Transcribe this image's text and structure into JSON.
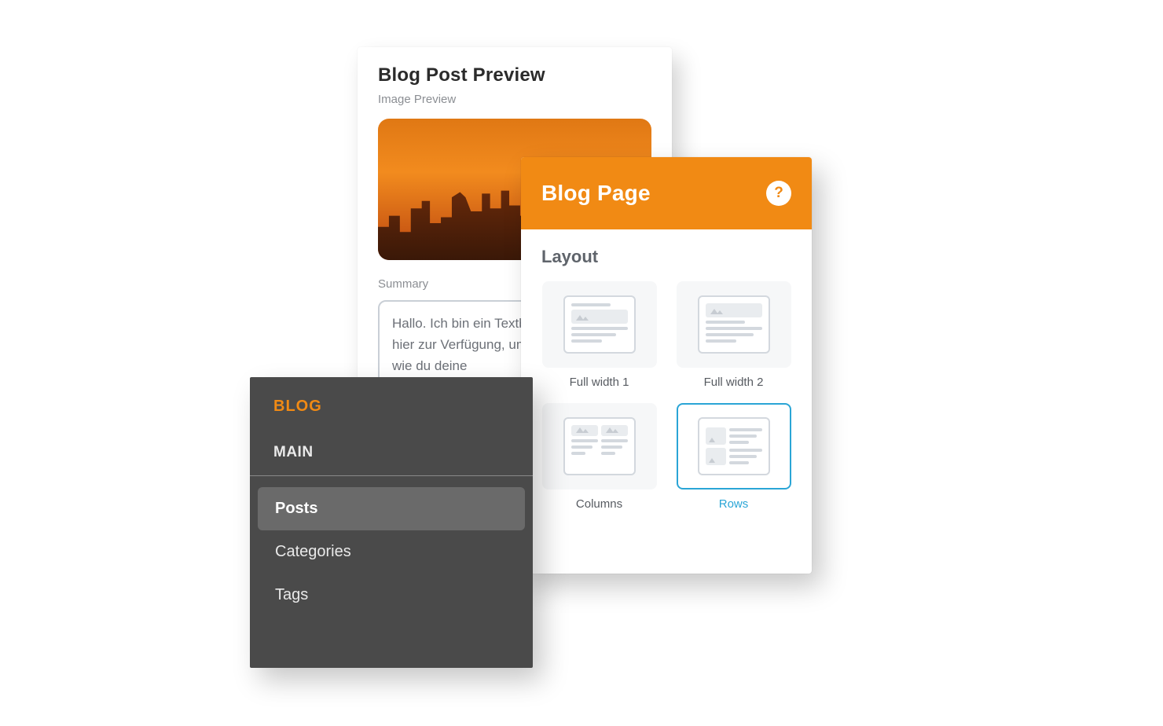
{
  "preview": {
    "title": "Blog Post Preview",
    "image_label": "Image Preview",
    "summary_label": "Summary",
    "summary_text": "Hallo. Ich bin ein Textbaustein, der dir hier zur Verfügung, um dir zu erklären, wie du deine"
  },
  "blog_page": {
    "header_title": "Blog Page",
    "help_symbol": "?",
    "section_title": "Layout",
    "layouts": [
      {
        "label": "Full width 1",
        "type": "full1",
        "selected": false
      },
      {
        "label": "Full width 2",
        "type": "full2",
        "selected": false
      },
      {
        "label": "Columns",
        "type": "columns",
        "selected": false
      },
      {
        "label": "Rows",
        "type": "rows",
        "selected": true
      }
    ]
  },
  "sidebar": {
    "heading": "BLOG",
    "section": "MAIN",
    "items": [
      {
        "label": "Posts",
        "active": true
      },
      {
        "label": "Categories",
        "active": false
      },
      {
        "label": "Tags",
        "active": false
      }
    ]
  }
}
